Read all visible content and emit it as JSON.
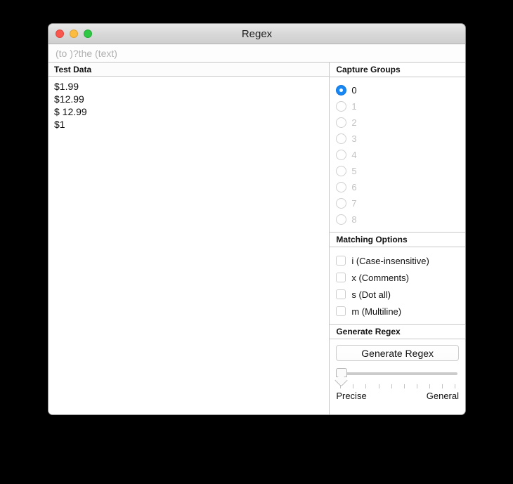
{
  "window": {
    "title": "Regex",
    "traffic_lights": [
      {
        "name": "close",
        "color": "#f9564d"
      },
      {
        "name": "minimize",
        "color": "#fcbc3f"
      },
      {
        "name": "maximize",
        "color": "#2fc744"
      }
    ]
  },
  "regex_field": {
    "value": "",
    "placeholder": "(to )?the (text)"
  },
  "test_data": {
    "header": "Test Data",
    "rows": [
      "$1.99",
      "$12.99",
      "$ 12.99",
      "$1"
    ]
  },
  "capture_groups": {
    "header": "Capture Groups",
    "selected": "0",
    "items": [
      {
        "label": "0",
        "selected": true,
        "enabled": true
      },
      {
        "label": "1",
        "selected": false,
        "enabled": false
      },
      {
        "label": "2",
        "selected": false,
        "enabled": false
      },
      {
        "label": "3",
        "selected": false,
        "enabled": false
      },
      {
        "label": "4",
        "selected": false,
        "enabled": false
      },
      {
        "label": "5",
        "selected": false,
        "enabled": false
      },
      {
        "label": "6",
        "selected": false,
        "enabled": false
      },
      {
        "label": "7",
        "selected": false,
        "enabled": false
      },
      {
        "label": "8",
        "selected": false,
        "enabled": false
      }
    ]
  },
  "matching_options": {
    "header": "Matching Options",
    "items": [
      {
        "label": "i (Case-insensitive)",
        "checked": false
      },
      {
        "label": "x (Comments)",
        "checked": false
      },
      {
        "label": "s (Dot all)",
        "checked": false
      },
      {
        "label": "m (Multiline)",
        "checked": false
      }
    ]
  },
  "generate_regex": {
    "header": "Generate Regex",
    "button_label": "Generate Regex",
    "slider": {
      "value": 0,
      "min": 0,
      "max": 10,
      "tick_count": 10,
      "left_label": "Precise",
      "right_label": "General"
    }
  },
  "colors": {
    "accent": "#1886f3",
    "titlebar": "#d7d7d7",
    "divider": "#c9c9c9",
    "disabled_text": "#c2c2c2"
  }
}
